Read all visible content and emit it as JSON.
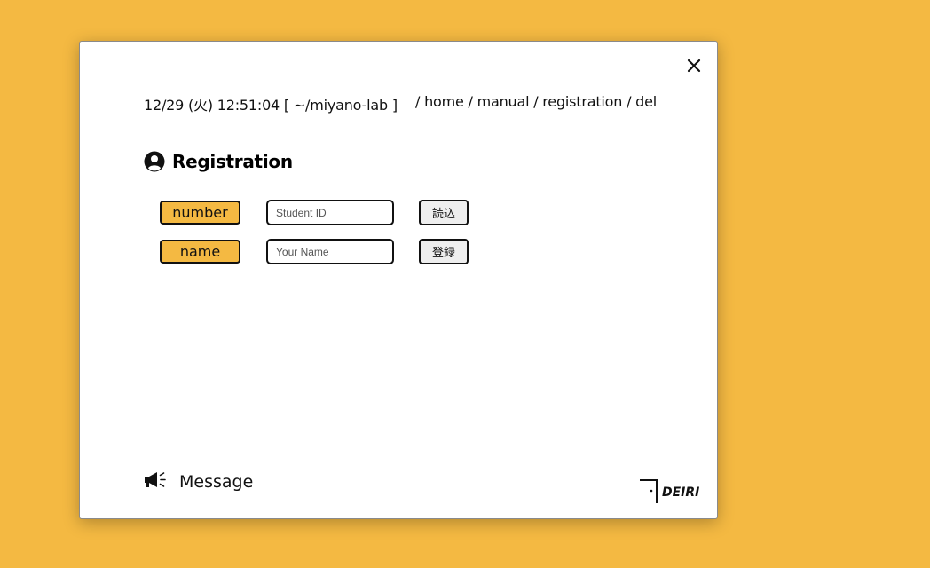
{
  "header": {
    "status_text": "12/29 (火) 12:51:04 [ ~/miyano-lab ]",
    "path_text": "/ home / manual / registration / del"
  },
  "icons": {
    "close": "close-icon",
    "title": "user-circle-icon",
    "message": "megaphone-icon",
    "logo": "deiri-logo"
  },
  "main": {
    "title": "Registration",
    "rows": [
      {
        "label": "number",
        "input_placeholder": "Student ID",
        "input_value": "",
        "button_label": "読込"
      },
      {
        "label": "name",
        "input_placeholder": "Your Name",
        "input_value": "",
        "button_label": "登録"
      }
    ]
  },
  "footer": {
    "message_label": "Message",
    "logo_text": "DEIRI"
  },
  "colors": {
    "background": "#F4B942",
    "accent": "#F4B942",
    "card": "#ffffff"
  }
}
